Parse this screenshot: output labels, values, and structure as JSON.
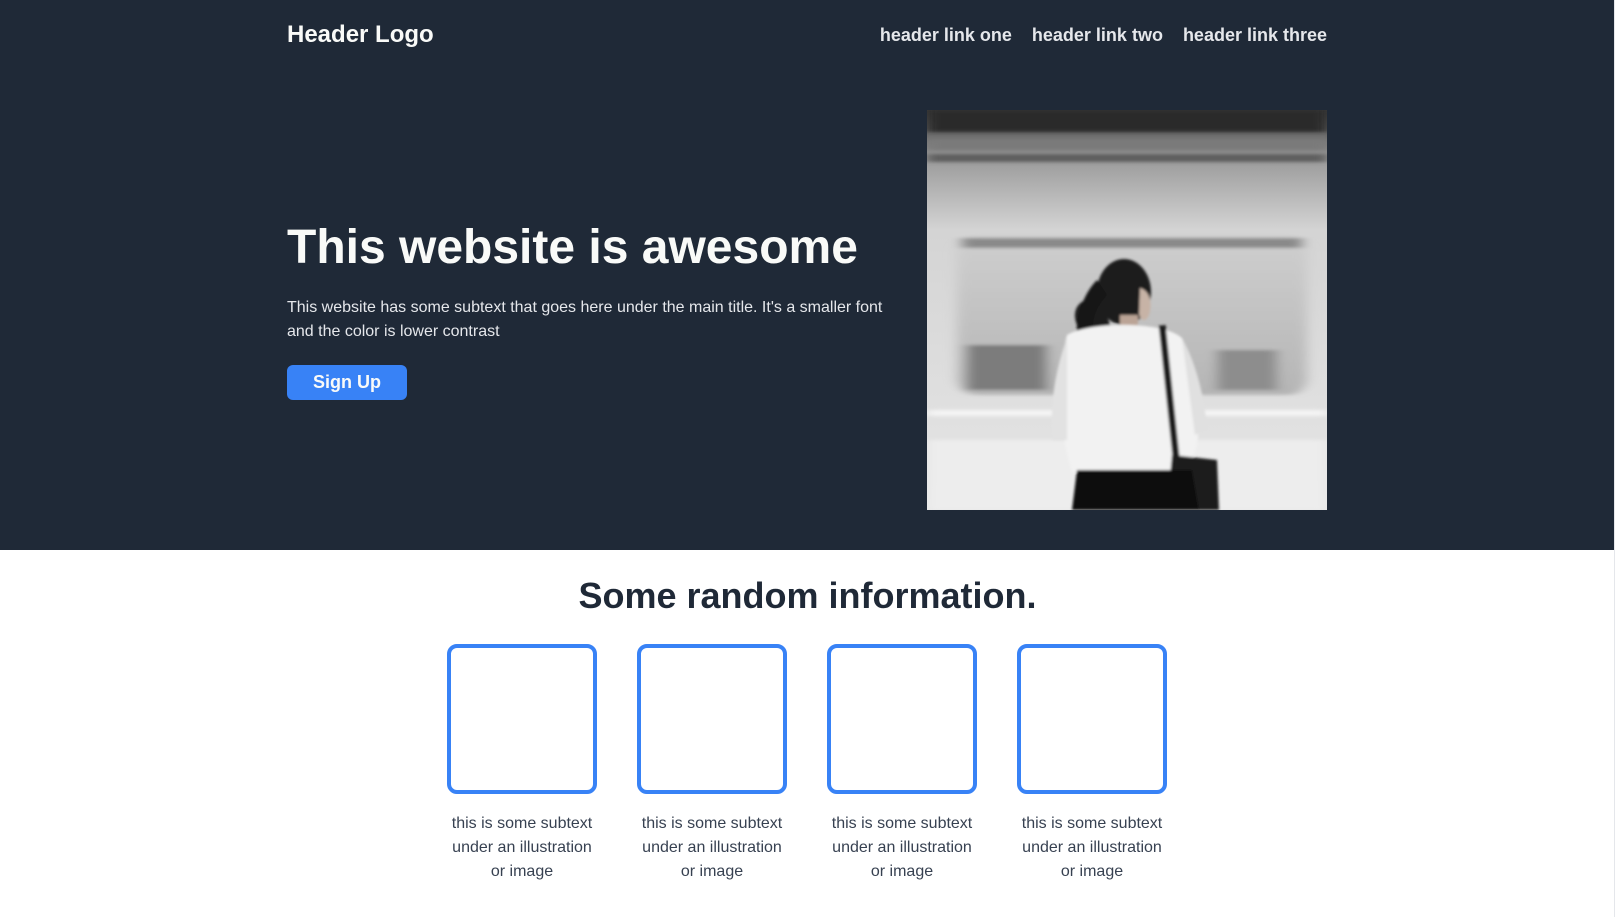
{
  "colors": {
    "hero_bg": "#1f2937",
    "accent": "#3882f6",
    "light_text": "#f9faf8",
    "muted_text": "#e5e7eb",
    "dark_text": "#1f2937",
    "body_text": "#374151"
  },
  "header": {
    "logo": "Header Logo",
    "links": [
      "header link one",
      "header link two",
      "header link three"
    ]
  },
  "hero": {
    "title": "This website is awesome",
    "subtext": "This website has some subtext that goes here under the main title. It's a smaller font and the color is lower contrast",
    "signup_label": "Sign Up"
  },
  "info": {
    "title": "Some random information.",
    "cards": [
      {
        "text": "this is some subtext under an illustration or image"
      },
      {
        "text": "this is some subtext under an illustration or image"
      },
      {
        "text": "this is some subtext under an illustration or image"
      },
      {
        "text": "this is some subtext under an illustration or image"
      }
    ]
  }
}
